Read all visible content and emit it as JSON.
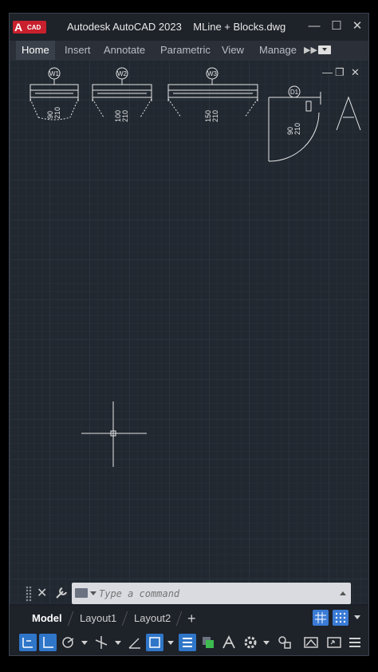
{
  "app": {
    "logo_letter": "A",
    "logo_label": "CAD",
    "window_title": "Autodesk AutoCAD 2023    MLine + Blocks.dwg"
  },
  "ribbon": {
    "tabs": [
      {
        "label": "Home",
        "active": true
      },
      {
        "label": "Insert",
        "active": false
      },
      {
        "label": "Annotate",
        "active": false
      },
      {
        "label": "Parametric",
        "active": false
      },
      {
        "label": "View",
        "active": false
      },
      {
        "label": "Manage",
        "active": false
      }
    ],
    "more_icon": "double-chevron-right-icon"
  },
  "drawing": {
    "blocks": [
      {
        "tag": "W1",
        "dim_a": "90",
        "dim_b": "210"
      },
      {
        "tag": "W2",
        "dim_a": "100",
        "dim_b": "210"
      },
      {
        "tag": "W3",
        "dim_a": "150",
        "dim_b": "210"
      },
      {
        "tag": "D1",
        "dim_a": "90",
        "dim_b": "210"
      }
    ],
    "viewport_controls": [
      "minimize-icon",
      "restore-icon",
      "close-icon"
    ]
  },
  "command": {
    "placeholder": "Type a command"
  },
  "layout_tabs": [
    {
      "label": "Model",
      "active": true
    },
    {
      "label": "Layout1",
      "active": false
    },
    {
      "label": "Layout2",
      "active": false
    }
  ],
  "add_layout_label": "+",
  "colors": {
    "accent_blue": "#2f76c9",
    "autocad_red": "#c8202d",
    "canvas_bg": "#212830"
  }
}
